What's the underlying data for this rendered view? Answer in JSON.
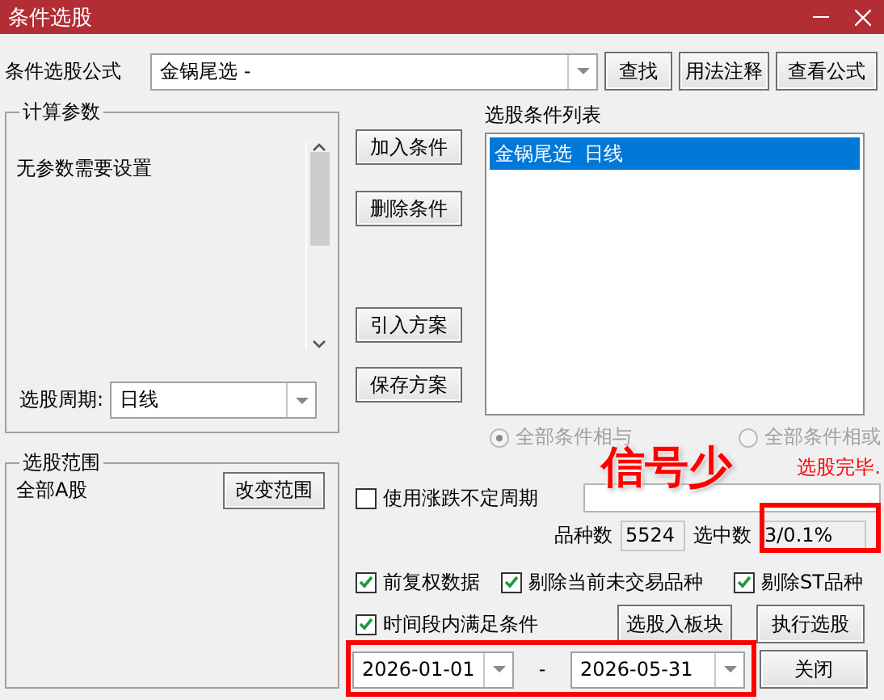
{
  "window": {
    "title": "条件选股"
  },
  "formula": {
    "label": "条件选股公式",
    "value": "金锅尾选  -"
  },
  "top_buttons": [
    "查找",
    "用法注释",
    "查看公式"
  ],
  "params_group": {
    "title": "计算参数",
    "text": "无参数需要设置",
    "period_label": "选股周期:",
    "period_value": "日线"
  },
  "scope_group": {
    "title": "选股范围",
    "text": "全部A股",
    "button": "改变范围"
  },
  "condition_buttons": [
    "加入条件",
    "删除条件",
    "引入方案",
    "保存方案"
  ],
  "condition_list": {
    "label": "选股条件列表",
    "items": [
      {
        "text": "金锅尾选  日线",
        "selected": true
      }
    ]
  },
  "logic": [
    {
      "label": "全部条件相与",
      "selected": true,
      "disabled": true
    },
    {
      "label": "全部条件相或",
      "selected": false,
      "disabled": true
    }
  ],
  "status": "选股完毕.",
  "variable_period": {
    "label": "使用涨跌不定周期",
    "checked": false
  },
  "counts": [
    {
      "label": "品种数",
      "value": "5524"
    },
    {
      "label": "选中数",
      "value": "3/0.1%"
    }
  ],
  "options": [
    {
      "label": "前复权数据",
      "checked": true
    },
    {
      "label": "剔除当前未交易品种",
      "checked": true
    },
    {
      "label": "剔除ST品种",
      "checked": true
    },
    {
      "label": "时间段内满足条件",
      "checked": true
    }
  ],
  "date_range": {
    "start": "2026-01-01",
    "separator": "-",
    "end": "2026-05-31"
  },
  "action_buttons": [
    "选股入板块",
    "执行选股",
    "关闭"
  ],
  "annotation": {
    "text": "信号少"
  }
}
